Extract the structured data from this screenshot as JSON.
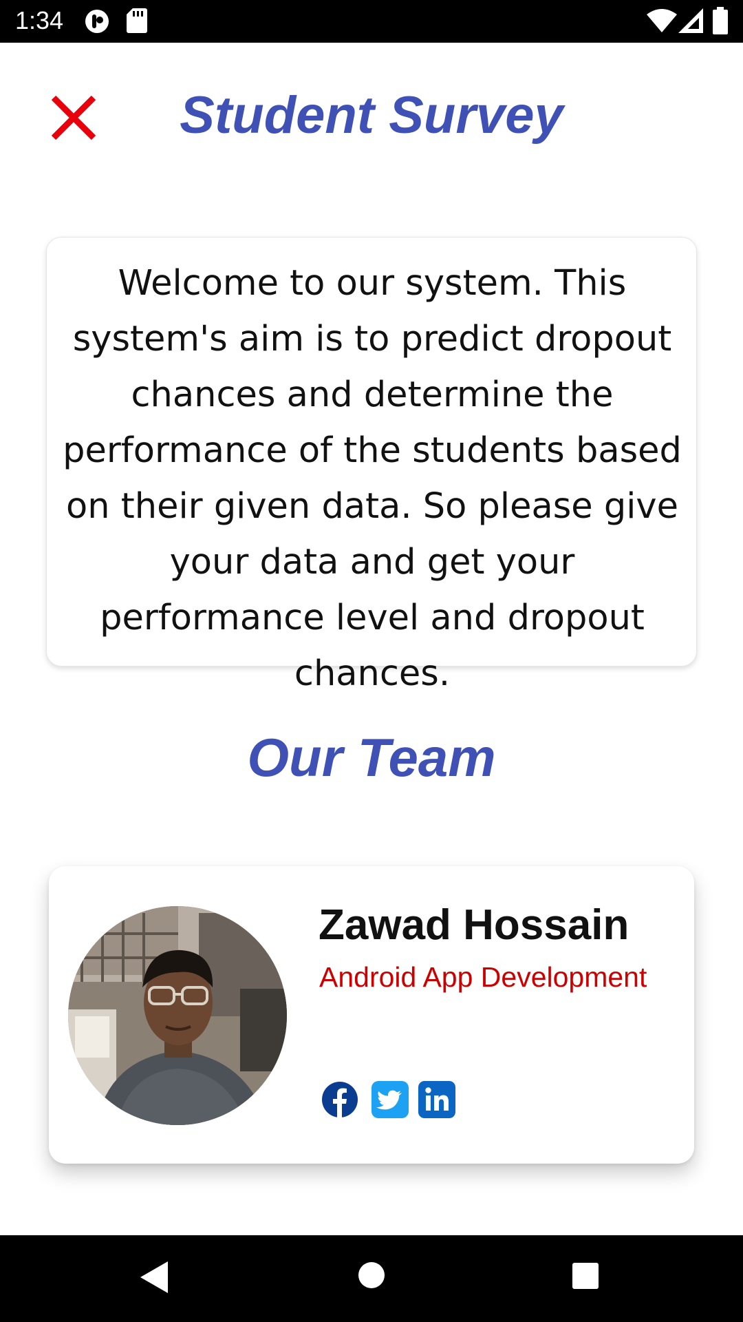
{
  "status_bar": {
    "time": "1:34",
    "icons": [
      "circle-notification-icon",
      "sd-card-icon",
      "wifi-icon",
      "signal-icon",
      "battery-icon"
    ]
  },
  "header": {
    "title": "Student Survey",
    "close_icon": "close-icon"
  },
  "welcome": {
    "text": "Welcome to our system. This system's aim is to predict dropout chances and determine the performance of the students based on their given data. So please give your data and get your performance level and dropout chances."
  },
  "team": {
    "section_title": "Our Team",
    "members": [
      {
        "name": "Zawad Hossain",
        "role": "Android App Development",
        "social": [
          "facebook-icon",
          "twitter-icon",
          "linkedin-icon"
        ]
      }
    ]
  },
  "nav_bar": {
    "buttons": [
      "back-icon",
      "home-icon",
      "recents-icon"
    ]
  },
  "colors": {
    "accent": "#3f51b5",
    "close": "#e8000b",
    "role": "#cc0000",
    "facebook": "#0a3d8f",
    "twitter": "#1da1f2",
    "linkedin": "#0a66c2"
  }
}
